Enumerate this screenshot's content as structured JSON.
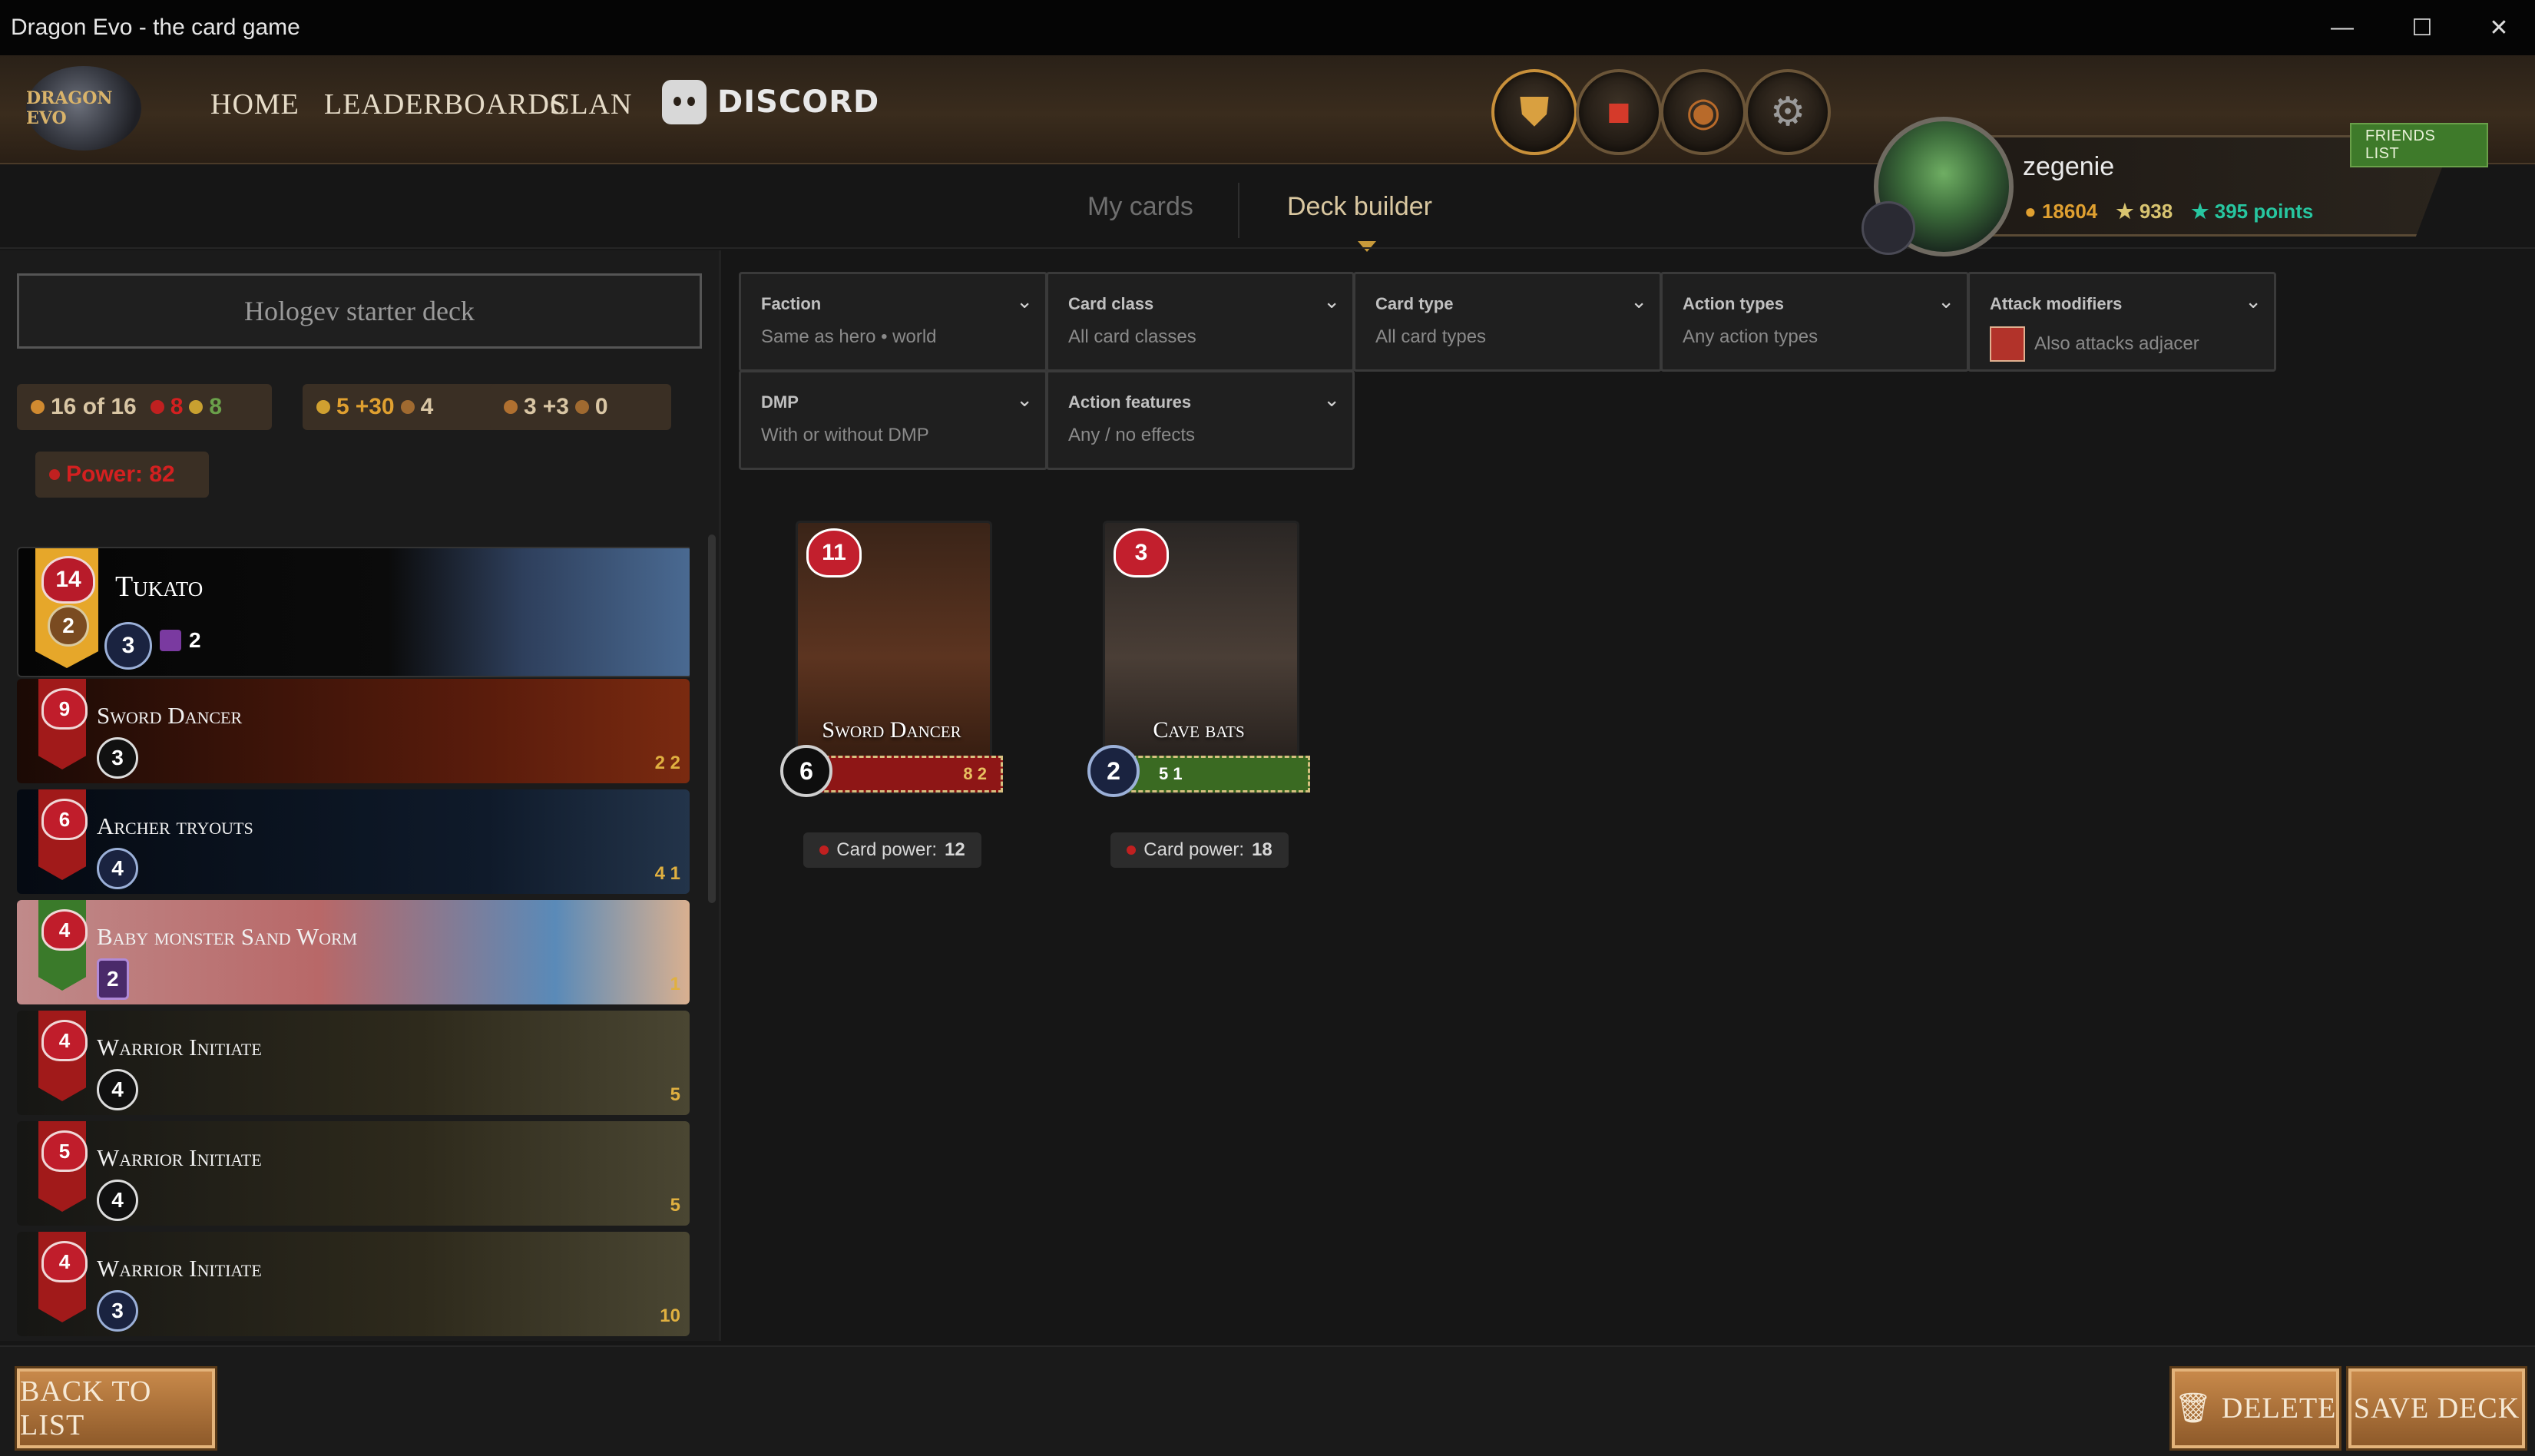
{
  "window": {
    "title": "Dragon Evo - the card game",
    "controls": [
      "minimize",
      "maximize",
      "close"
    ]
  },
  "nav": {
    "logo_text": "DRAGON EVO",
    "links": [
      "HOME",
      "LEADERBOARDS",
      "CLAN"
    ],
    "discord_label": "DISCORD",
    "round_buttons": [
      "shield-icon",
      "book-icon",
      "pouch-icon",
      "gear-icon"
    ]
  },
  "profile": {
    "name": "zegenie",
    "friends_label": "FRIENDS LIST",
    "gold": "18604",
    "trophies": "938",
    "points": "395 points"
  },
  "tabs": {
    "my_cards": "My cards",
    "deck_builder": "Deck builder"
  },
  "deck": {
    "name": "Hologev starter deck",
    "stats": {
      "count": "16 of 16",
      "red": "8",
      "green": "8",
      "gold": "5",
      "gold_bonus": "+30",
      "bag": "4",
      "sword": "3",
      "sword_bonus": "+3",
      "sword_bag": "0",
      "power_label": "Power: 82"
    }
  },
  "hero": {
    "name": "Tukato",
    "hp": "14",
    "level": "2",
    "attack": "3",
    "extra": "2"
  },
  "cards": [
    {
      "name": "Sword Dancer",
      "hp": "9",
      "attack": "3",
      "cost": "2 2",
      "color": "#5a1c0c"
    },
    {
      "name": "Archer tryouts",
      "hp": "6",
      "attack": "4",
      "cost": "4 1",
      "color": "#0f1a2a"
    },
    {
      "name": "Baby monster Sand Worm",
      "hp": "4",
      "attack": "2",
      "cost": "1",
      "color": "#b86868"
    },
    {
      "name": "Warrior Initiate",
      "hp": "4",
      "attack": "4",
      "cost": "5",
      "color": "#2e2a1c"
    },
    {
      "name": "Warrior Initiate",
      "hp": "5",
      "attack": "4",
      "cost": "5",
      "color": "#2e2a1c"
    },
    {
      "name": "Warrior Initiate",
      "hp": "4",
      "attack": "3",
      "cost": "10",
      "color": "#2e2a1c"
    }
  ],
  "filters": [
    {
      "label": "Faction",
      "value": "Same as hero • world"
    },
    {
      "label": "Card class",
      "value": "All card classes"
    },
    {
      "label": "Card type",
      "value": "All card types"
    },
    {
      "label": "Action types",
      "value": "Any action types"
    },
    {
      "label": "Attack modifiers",
      "value": "Also attacks adjacer"
    },
    {
      "label": "DMP",
      "value": "With or without DMP"
    },
    {
      "label": "Action features",
      "value": "Any / no effects"
    }
  ],
  "grid_cards": [
    {
      "name": "Sword Dancer",
      "hp": "11",
      "attack": "6",
      "bar_stats": "8 2",
      "power_label": "Card power:",
      "power": "12"
    },
    {
      "name": "Cave bats",
      "hp": "3",
      "attack": "2",
      "bar_stats": "5 1",
      "power_label": "Card power:",
      "power": "18"
    }
  ],
  "buttons": {
    "back": "BACK TO LIST",
    "delete": "DELETE",
    "save": "SAVE DECK"
  }
}
